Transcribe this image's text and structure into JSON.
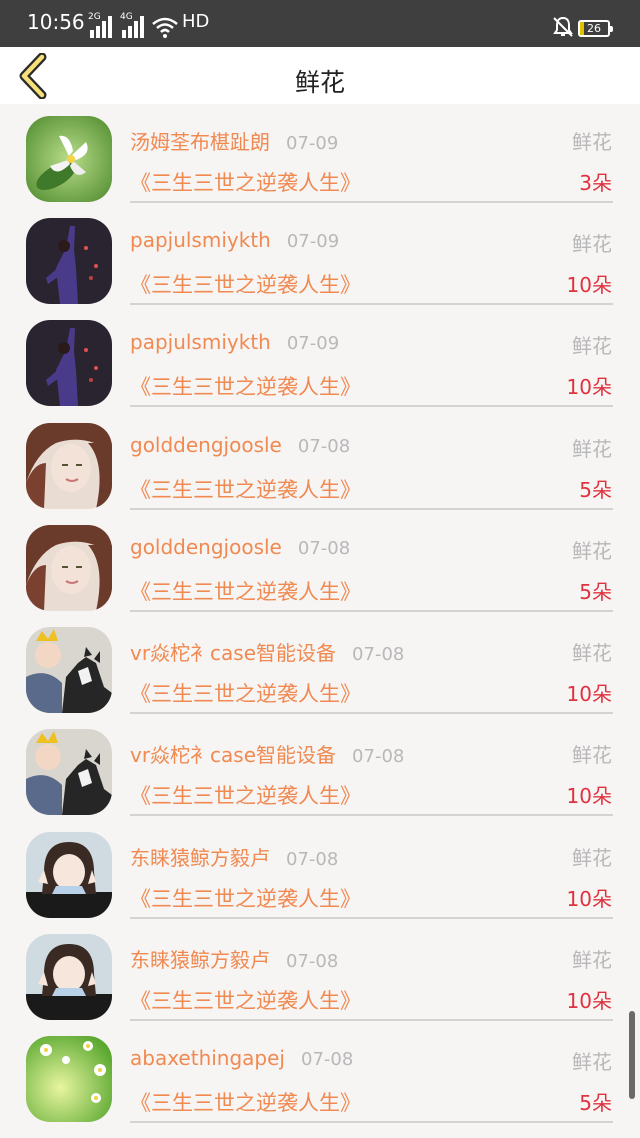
{
  "status": {
    "time": "10:56",
    "net1": "2G",
    "net2": "4G",
    "hd": "HD",
    "battery": "26"
  },
  "header": {
    "title": "鲜花"
  },
  "list": [
    {
      "name": "汤姆荃布椹趾朗",
      "date": "07-09",
      "type": "鲜花",
      "book": "《三生三世之逆袭人生》",
      "qty": "3朵",
      "avatar": "flower-white"
    },
    {
      "name": "papjulsmiykth",
      "date": "07-09",
      "type": "鲜花",
      "book": "《三生三世之逆袭人生》",
      "qty": "10朵",
      "avatar": "stage-performer"
    },
    {
      "name": "papjulsmiykth",
      "date": "07-09",
      "type": "鲜花",
      "book": "《三生三世之逆袭人生》",
      "qty": "10朵",
      "avatar": "stage-performer"
    },
    {
      "name": "golddengjoosle",
      "date": "07-08",
      "type": "鲜花",
      "book": "《三生三世之逆袭人生》",
      "qty": "5朵",
      "avatar": "woman-portrait"
    },
    {
      "name": "golddengjoosle",
      "date": "07-08",
      "type": "鲜花",
      "book": "《三生三世之逆袭人生》",
      "qty": "5朵",
      "avatar": "woman-portrait"
    },
    {
      "name": "vr焱柁衤case智能设备",
      "date": "07-08",
      "type": "鲜花",
      "book": "《三生三世之逆袭人生》",
      "qty": "10朵",
      "avatar": "child-dog"
    },
    {
      "name": "vr焱柁衤case智能设备",
      "date": "07-08",
      "type": "鲜花",
      "book": "《三生三世之逆袭人生》",
      "qty": "10朵",
      "avatar": "child-dog"
    },
    {
      "name": "东睐猿鲸方毅卢",
      "date": "07-08",
      "type": "鲜花",
      "book": "《三生三世之逆袭人生》",
      "qty": "10朵",
      "avatar": "girl-peace"
    },
    {
      "name": "东睐猿鲸方毅卢",
      "date": "07-08",
      "type": "鲜花",
      "book": "《三生三世之逆袭人生》",
      "qty": "10朵",
      "avatar": "girl-peace"
    },
    {
      "name": "abaxethingapej",
      "date": "07-08",
      "type": "鲜花",
      "book": "《三生三世之逆袭人生》",
      "qty": "5朵",
      "avatar": "green-flowers"
    }
  ]
}
